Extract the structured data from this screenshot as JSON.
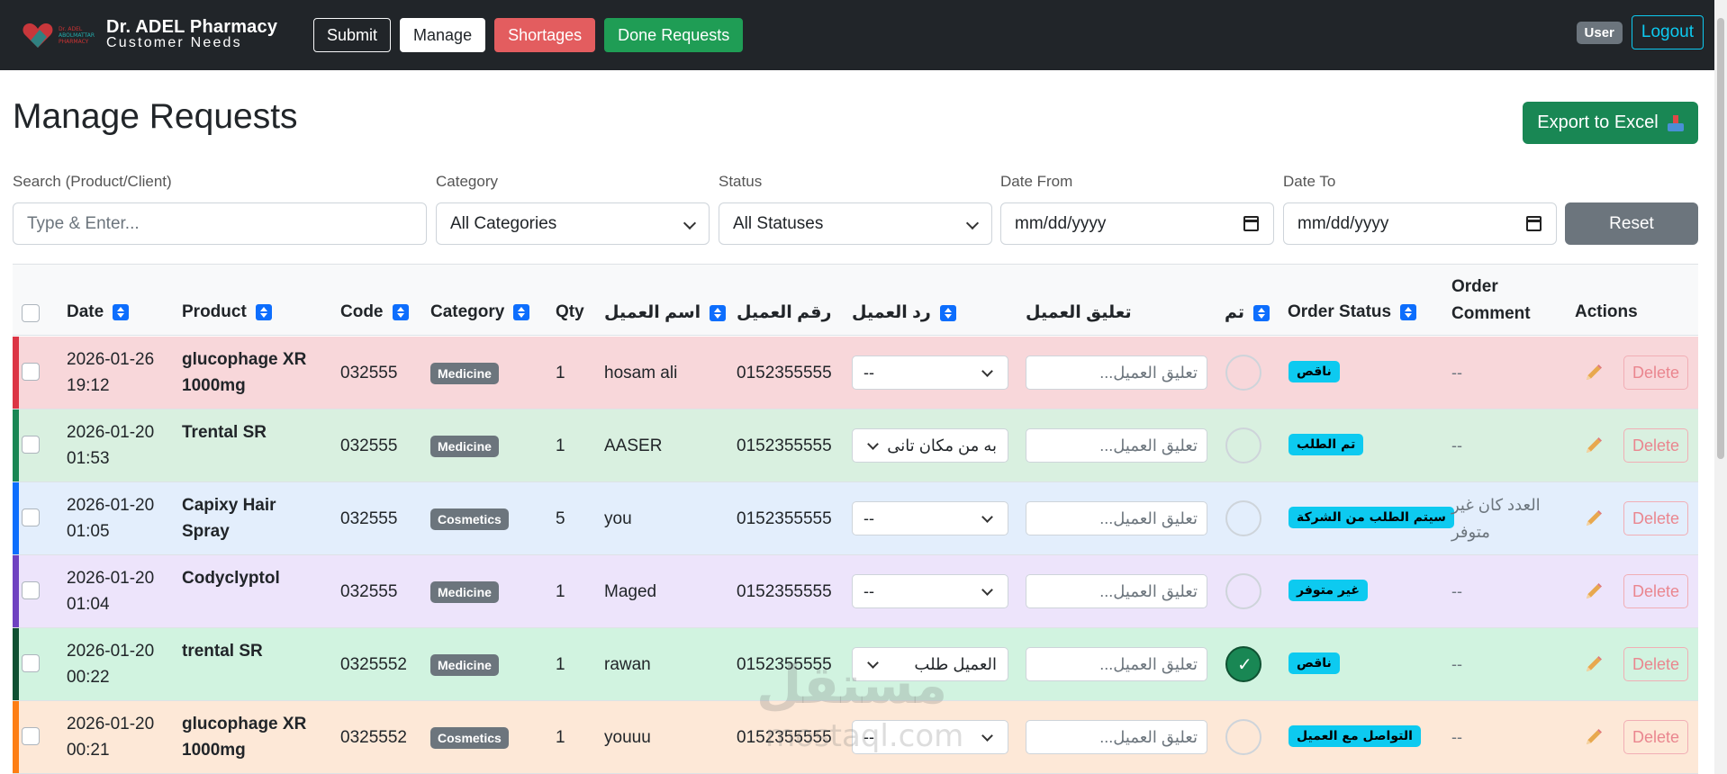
{
  "brand": {
    "logo_line1": "Dr. ADEL",
    "logo_line2": "ABOLMATTAR",
    "logo_line3": "PHARMACY",
    "name": "Dr. ADEL Pharmacy",
    "tagline": "Customer Needs"
  },
  "nav": {
    "submit": "Submit",
    "manage": "Manage",
    "shortages": "Shortages",
    "done": "Done Requests",
    "user": "User",
    "logout": "Logout"
  },
  "page": {
    "title": "Manage Requests",
    "export": "Export to Excel"
  },
  "filters": {
    "search_label": "Search (Product/Client)",
    "search_placeholder": "Type & Enter...",
    "category_label": "Category",
    "category_value": "All Categories",
    "status_label": "Status",
    "status_value": "All Statuses",
    "date_from_label": "Date From",
    "date_from_value": "mm/dd/yyyy",
    "date_to_label": "Date To",
    "date_to_value": "mm/dd/yyyy",
    "reset": "Reset"
  },
  "table": {
    "headers": {
      "date": "Date",
      "product": "Product",
      "code": "Code",
      "category": "Category",
      "qty": "Qty",
      "client_name": "اسم العميل",
      "client_number": "رقم العميل",
      "client_reply": "رد العميل",
      "client_comment": "تعليق العميل",
      "done": "تم",
      "order_status": "Order Status",
      "order_comment_1": "Order",
      "order_comment_2": "Comment",
      "actions": "Actions"
    },
    "comment_placeholder": "تعليق العميل...",
    "delete_label": "Delete",
    "rows": [
      {
        "date1": "2026-01-26",
        "date2": "19:12",
        "product1": "glucophage XR",
        "product2": "1000mg",
        "code": "032555",
        "category": "Medicine",
        "qty": "1",
        "name": "hosam ali",
        "number": "0152355555",
        "reply": "--",
        "done": false,
        "status": "ناقص",
        "comment1": "--",
        "comment2": "",
        "bar_color": "#dc3545",
        "bg": "#f8d7da"
      },
      {
        "date1": "2026-01-20",
        "date2": "01:53",
        "product1": "Trental SR",
        "product2": "",
        "code": "032555",
        "category": "Medicine",
        "qty": "1",
        "name": "AASER",
        "number": "0152355555",
        "reply": "به من مكان تانى",
        "done": false,
        "status": "تم الطلب",
        "comment1": "--",
        "comment2": "",
        "bar_color": "#198754",
        "bg": "#d9f0e0"
      },
      {
        "date1": "2026-01-20",
        "date2": "01:05",
        "product1": "Capixy Hair",
        "product2": "Spray",
        "code": "032555",
        "category": "Cosmetics",
        "qty": "5",
        "name": "you",
        "number": "0152355555",
        "reply": "--",
        "done": false,
        "status": "سيتم الطلب من الشركة",
        "comment1": "العدد كان غير",
        "comment2": "متوفر",
        "bar_color": "#0d6efd",
        "bg": "#e3eefc"
      },
      {
        "date1": "2026-01-20",
        "date2": "01:04",
        "product1": "Codyclyptol",
        "product2": "",
        "code": "032555",
        "category": "Medicine",
        "qty": "1",
        "name": "Maged",
        "number": "0152355555",
        "reply": "--",
        "done": false,
        "status": "غير متوفر",
        "comment1": "--",
        "comment2": "",
        "bar_color": "#6f42c1",
        "bg": "#ede4fb"
      },
      {
        "date1": "2026-01-20",
        "date2": "00:22",
        "product1": "trental SR",
        "product2": "",
        "code": "0325552",
        "category": "Medicine",
        "qty": "1",
        "name": "rawan",
        "number": "0152355555",
        "reply": "العميل طلب",
        "done": true,
        "status": "ناقص",
        "comment1": "--",
        "comment2": "",
        "bar_color": "#0f5132",
        "bg": "#d1f3e0"
      },
      {
        "date1": "2026-01-20",
        "date2": "00:21",
        "product1": "glucophage XR",
        "product2": "1000mg",
        "code": "0325552",
        "category": "Cosmetics",
        "qty": "1",
        "name": "youuu",
        "number": "0152355555",
        "reply": "--",
        "done": false,
        "status": "التواصل مع العميل",
        "comment1": "--",
        "comment2": "",
        "bar_color": "#fd7e14",
        "bg": "#fde8d7"
      }
    ]
  },
  "watermark": {
    "line1": "مستقل",
    "line2": "mostaql.com"
  },
  "icons": {
    "sort": "sort-icon",
    "edit": "pencil-icon",
    "calendar": "calendar-icon",
    "export": "download-tray-icon"
  }
}
